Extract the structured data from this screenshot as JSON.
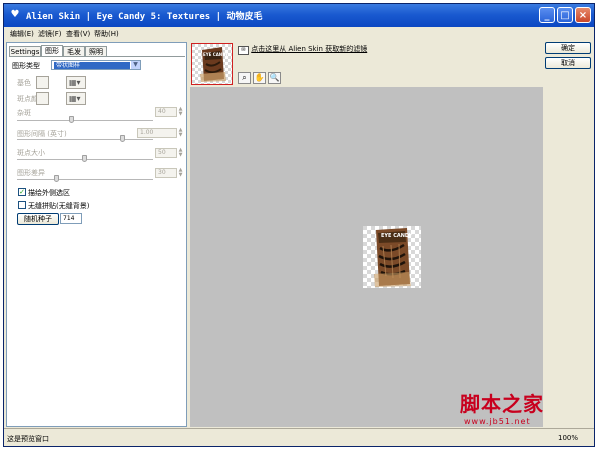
{
  "window": {
    "title": "Alien Skin | Eye Candy 5: Textures | 动物皮毛",
    "minimize": "_",
    "maximize": "□",
    "close": "×"
  },
  "menu": [
    {
      "label": "编辑(E)"
    },
    {
      "label": "滤镜(F)"
    },
    {
      "label": "查看(V)"
    },
    {
      "label": "帮助(H)"
    }
  ],
  "tabs": [
    {
      "label": "Settings"
    },
    {
      "label": "图形"
    },
    {
      "label": "毛发"
    },
    {
      "label": "照明"
    }
  ],
  "controls": {
    "pattern_type_label": "图形类型",
    "pattern_type_value": "带状图样",
    "base_color_label": "基色",
    "spot_color_label": "斑点颜色",
    "noise_label": "杂斑",
    "noise_value": "40",
    "spacing_label": "图形间隔 (英寸)",
    "spacing_value": "1.00",
    "spot_size_label": "斑点大小",
    "spot_size_value": "50",
    "diff_label": "图形差异",
    "diff_value": "30",
    "outside_label": "描绘外侧选区",
    "outside_checked": true,
    "seamless_label": "无缝拼贴(无缝背景)",
    "seamless_checked": false,
    "seed_button": "随机种子",
    "seed_value": "714"
  },
  "preview": {
    "link_text": "点击这里从 Alien Skin 获取新的滤镜",
    "thumb_title": "EYE CANDY",
    "canvas_title": "EYE CANDY"
  },
  "buttons": {
    "ok": "确定",
    "cancel": "取消"
  },
  "status": {
    "text": "这是预览窗口",
    "zoom": "100%"
  },
  "watermark": {
    "big": "脚本之家",
    "small": "www.jb51.net"
  }
}
